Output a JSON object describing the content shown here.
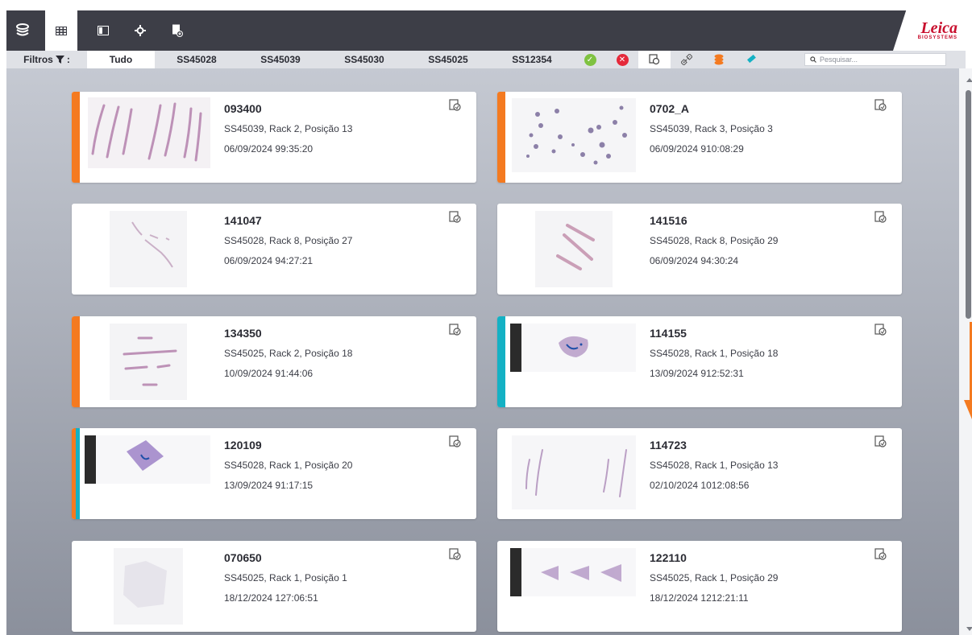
{
  "toolbar": {
    "icons": [
      "stack-icon",
      "grid-icon",
      "slide-view-icon",
      "settings-icon",
      "export-icon"
    ]
  },
  "logo": {
    "name": "Leica",
    "sub": "BIOSYSTEMS"
  },
  "filters": {
    "label": "Filtros",
    "tabs": [
      "Tudo",
      "SS45028",
      "SS45039",
      "SS45030",
      "SS45025",
      "SS12354"
    ],
    "search_placeholder": "Pesquisar..."
  },
  "cards": [
    {
      "id": "093400",
      "location": "SS45039, Rack 2, Posição 13",
      "date": "06/09/2024 99:35:20",
      "stripe": "orange"
    },
    {
      "id": "0702_A",
      "location": "SS45039, Rack 3, Posição 3",
      "date": "06/09/2024 910:08:29",
      "stripe": "orange"
    },
    {
      "id": "141047",
      "location": "SS45028, Rack 8, Posição 27",
      "date": "06/09/2024 94:27:21",
      "stripe": "none"
    },
    {
      "id": "141516",
      "location": "SS45028, Rack 8, Posição 29",
      "date": "06/09/2024 94:30:24",
      "stripe": "none"
    },
    {
      "id": "134350",
      "location": "SS45025, Rack 2, Posição 18",
      "date": "10/09/2024 91:44:06",
      "stripe": "orange"
    },
    {
      "id": "114155",
      "location": "SS45028, Rack 1, Posição 18",
      "date": "13/09/2024 912:52:31",
      "stripe": "teal"
    },
    {
      "id": "120109",
      "location": "SS45028, Rack 1, Posição 20",
      "date": "13/09/2024 91:17:15",
      "stripe": "dual"
    },
    {
      "id": "114723",
      "location": "SS45028, Rack 1, Posição 13",
      "date": "02/10/2024 1012:08:56",
      "stripe": "none"
    },
    {
      "id": "070650",
      "location": "SS45025, Rack 1, Posição 1",
      "date": "18/12/2024 127:06:51",
      "stripe": "none"
    },
    {
      "id": "122110",
      "location": "SS45025, Rack 1, Posição 29",
      "date": "18/12/2024 1212:21:11",
      "stripe": "none"
    }
  ],
  "colors": {
    "topbar": "#3d3e47",
    "accent_orange": "#f47a20",
    "accent_teal": "#14b1c4",
    "brand_red": "#c8102e"
  }
}
